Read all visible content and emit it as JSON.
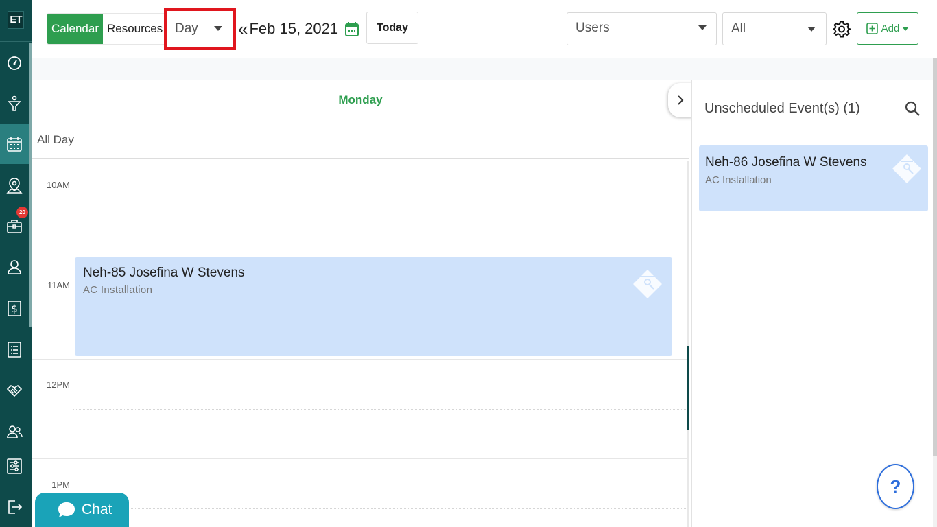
{
  "sidebar": {
    "logo": "ET",
    "items": [
      {
        "icon": "dashboard-gauge-icon"
      },
      {
        "icon": "funnel-icon"
      },
      {
        "icon": "calendar-icon",
        "active": true
      },
      {
        "icon": "map-pin-icon"
      },
      {
        "icon": "briefcase-icon",
        "badge": "20"
      },
      {
        "icon": "user-icon"
      },
      {
        "icon": "dollar-icon"
      },
      {
        "icon": "list-icon"
      },
      {
        "icon": "handshake-icon"
      },
      {
        "icon": "users-icon"
      },
      {
        "icon": "settings-sliders-icon"
      },
      {
        "icon": "logout-icon"
      }
    ]
  },
  "toolbar": {
    "view_toggle": {
      "calendar": "Calendar",
      "resources": "Resources"
    },
    "view_select": "Day",
    "date": "Feb 15, 2021",
    "prev": "«",
    "next": "»",
    "today": "Today",
    "users_select": "Users",
    "all_select": "All",
    "add": "Add"
  },
  "calendar": {
    "day_header": "Monday",
    "all_day_label": "All Day",
    "hours": [
      "10AM",
      "11AM",
      "12PM",
      "1PM"
    ],
    "event": {
      "title": "Neh-85 Josefina W Stevens",
      "subtitle": "AC Installation"
    }
  },
  "panel": {
    "title": "Unscheduled Event(s) (1)",
    "card": {
      "title": "Neh-86 Josefina W Stevens",
      "subtitle": "AC Installation"
    }
  },
  "help": "?",
  "chat": "Chat",
  "colors": {
    "sidebar": "#0e4a4a",
    "accent_green": "#2e9e4f",
    "event_blue": "#cfe2fb",
    "highlight_red": "#e0161e"
  }
}
